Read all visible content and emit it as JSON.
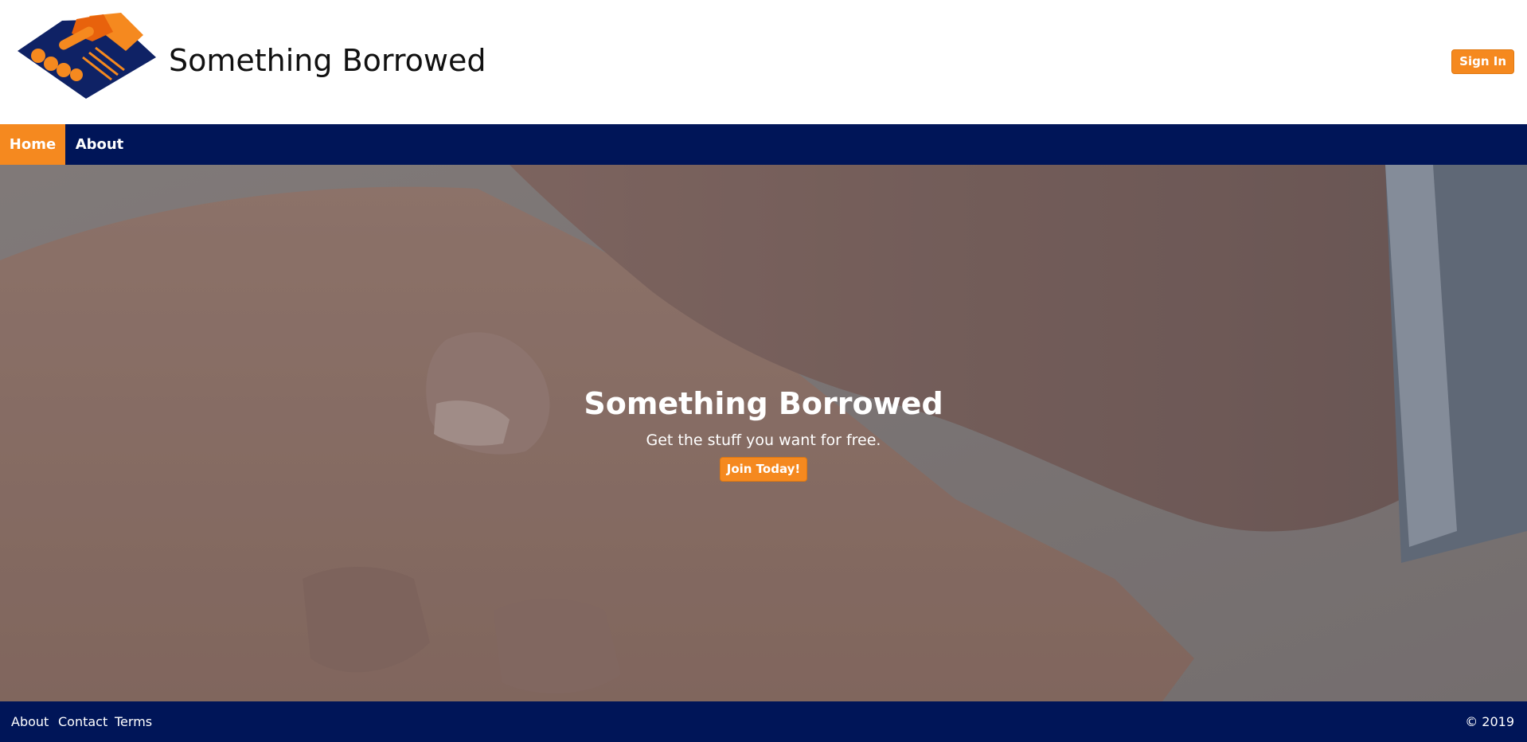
{
  "header": {
    "brand_title": "Something Borrowed",
    "signin_label": "Sign In",
    "logo_icon": "handshake-logo-icon"
  },
  "nav": {
    "items": [
      {
        "label": "Home",
        "active": true
      },
      {
        "label": "About",
        "active": false
      }
    ]
  },
  "hero": {
    "title": "Something Borrowed",
    "subtitle": "Get the stuff you want for free.",
    "cta_label": "Join Today!",
    "background": "handshake-photo"
  },
  "footer": {
    "links": [
      "About",
      "Contact",
      "Terms"
    ],
    "copyright": "© 2019"
  },
  "colors": {
    "accent": "#f5891f",
    "navy": "#001558",
    "white": "#ffffff"
  }
}
